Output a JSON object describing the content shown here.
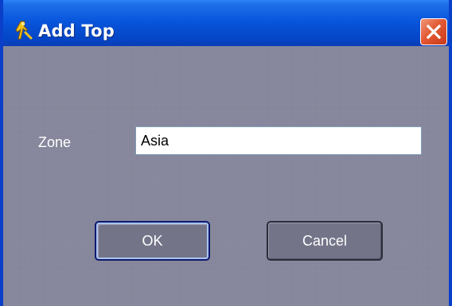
{
  "window": {
    "title": "Add Top",
    "icon": "key-figure-icon",
    "close_icon": "close-icon",
    "colors": {
      "titlebar": "#0856dc",
      "client_background": "#84849a",
      "close_button": "#e35a33"
    }
  },
  "form": {
    "zone_label": "Zone",
    "zone_value": "Asia"
  },
  "buttons": {
    "ok_label": "OK",
    "cancel_label": "Cancel"
  }
}
